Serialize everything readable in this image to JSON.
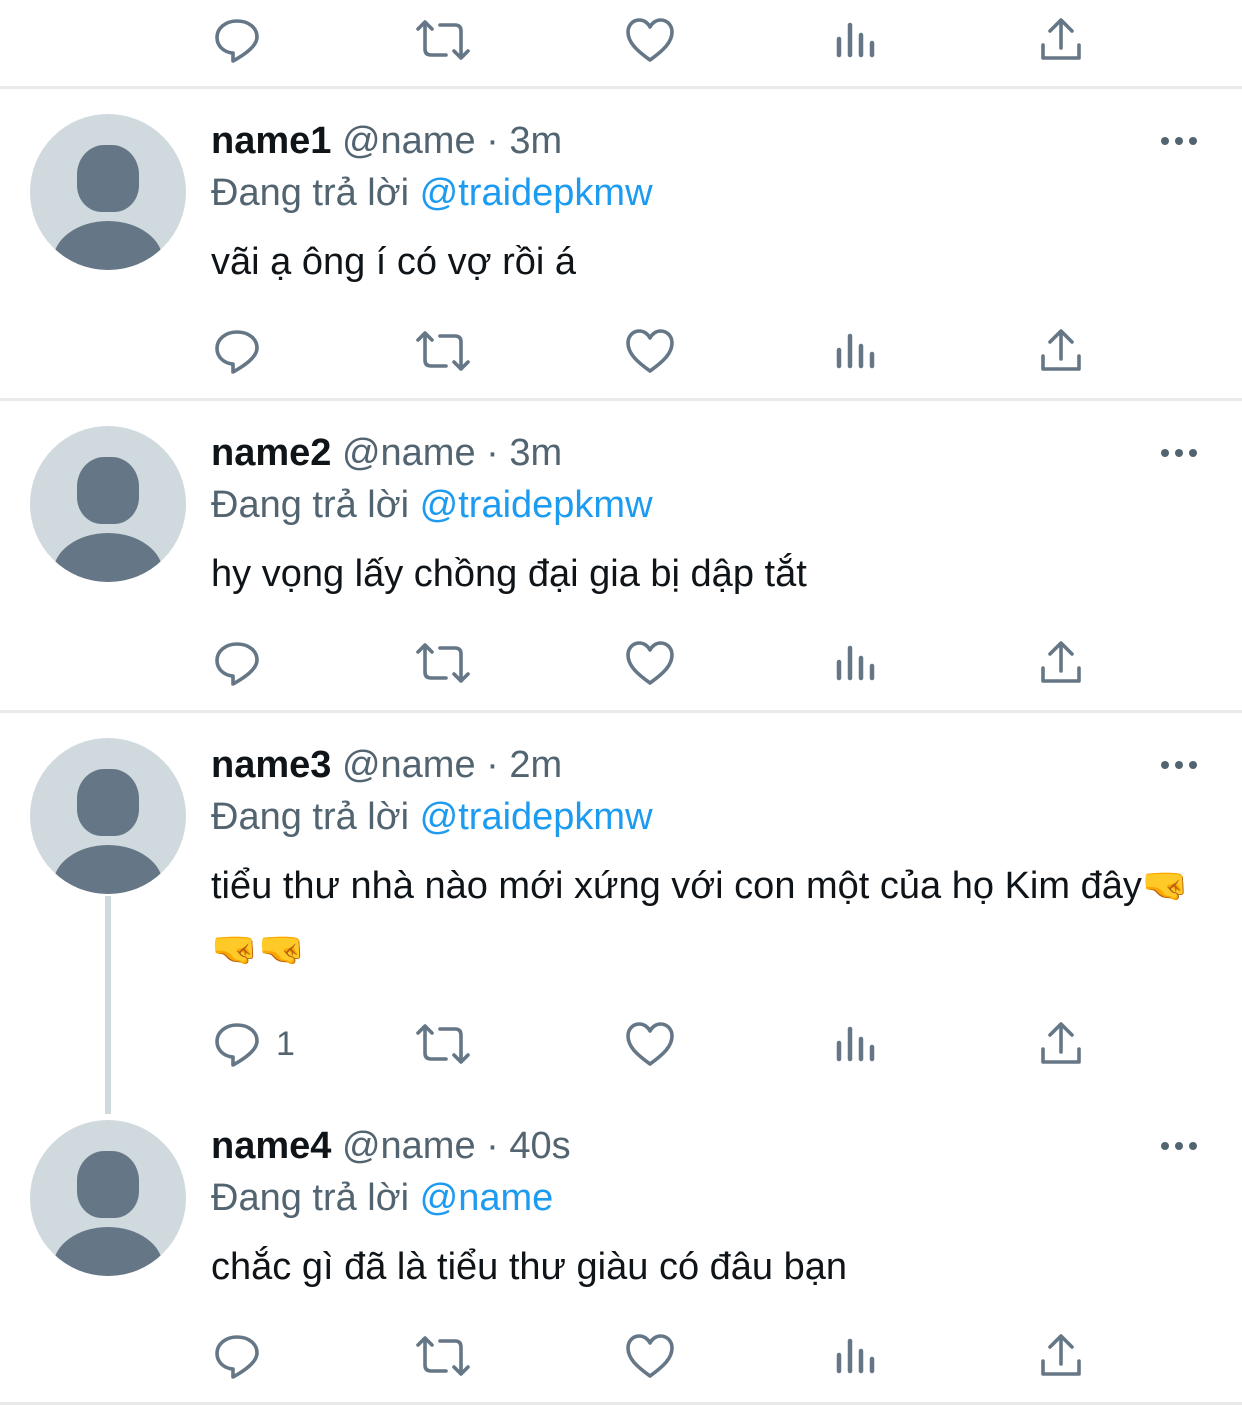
{
  "reply_prefix": "Đang trả lời",
  "top_actions": {
    "reply_count": ""
  },
  "tweets": [
    {
      "name": "name1",
      "handle": "@name",
      "sep": "·",
      "time": "3m",
      "reply_to": "@traidepkmw",
      "text": "vãi ạ ông í có vợ rồi á",
      "reply_count": ""
    },
    {
      "name": "name2",
      "handle": "@name",
      "sep": "·",
      "time": "3m",
      "reply_to": "@traidepkmw",
      "text": "hy vọng lấy chồng đại gia bị dập tắt",
      "reply_count": ""
    },
    {
      "name": "name3",
      "handle": "@name",
      "sep": "·",
      "time": "2m",
      "reply_to": "@traidepkmw",
      "text": "tiểu thư nhà nào mới xứng với con một của họ Kim đây🤜🤜🤜",
      "reply_count": "1"
    },
    {
      "name": "name4",
      "handle": "@name",
      "sep": "·",
      "time": "40s",
      "reply_to": "@name",
      "text": "chắc gì đã là tiểu thư giàu có đâu bạn",
      "reply_count": ""
    }
  ],
  "icons": [
    "reply-icon",
    "retweet-icon",
    "like-icon",
    "views-icon",
    "share-icon",
    "more-icon"
  ],
  "colors": {
    "text": "#0f1419",
    "muted": "#536471",
    "link": "#1d9bf0",
    "divider": "#e7e9ea",
    "avatar_bg": "#cfd9de",
    "avatar_fg": "#657786"
  }
}
